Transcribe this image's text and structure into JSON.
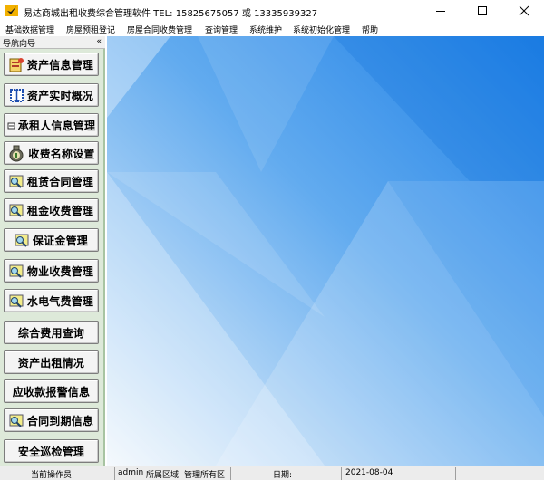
{
  "window": {
    "title": "易达商城出租收费综合管理软件  TEL: 15825675057 或 13335939327",
    "controls": [
      "minimize-icon",
      "maximize-icon",
      "close-icon"
    ]
  },
  "menu": [
    "基础数据管理",
    "房屋预租登记",
    "房屋合同收费管理",
    "查询管理",
    "系统维护",
    "系统初始化管理",
    "帮助"
  ],
  "sidebar": {
    "title": "导航向导",
    "collapse": "«",
    "items": [
      {
        "label": "资产信息管理",
        "icon": "asset-info-icon"
      },
      {
        "label": "资产实时概况",
        "icon": "asset-overview-icon"
      },
      {
        "label": "承租人信息管理",
        "icon": "tenant-info-icon"
      },
      {
        "label": "收费名称设置",
        "icon": "money-bag-icon"
      },
      {
        "label": "租赁合同管理",
        "icon": "lease-contract-icon"
      },
      {
        "label": "租金收费管理",
        "icon": "rent-fee-icon"
      },
      {
        "label": "保证金管理",
        "icon": "deposit-icon"
      },
      {
        "label": "物业收费管理",
        "icon": "property-fee-icon"
      },
      {
        "label": "水电气费管理",
        "icon": "utility-fee-icon"
      },
      {
        "label": "综合费用查询",
        "icon": ""
      },
      {
        "label": "资产出租情况",
        "icon": ""
      },
      {
        "label": "应收款报警信息",
        "icon": ""
      },
      {
        "label": "合同到期信息",
        "icon": "contract-expiry-icon"
      },
      {
        "label": "安全巡检管理",
        "icon": ""
      }
    ]
  },
  "status": {
    "operator_label": "当前操作员:",
    "operator_value": "admin",
    "area_label": "所属区域:",
    "area_value": "管理所有区",
    "date_label": "日期:",
    "date_value": "2021-08-04"
  },
  "colors": {
    "sidebar_bg": "#dde9d9",
    "main_bg_light": "#e6f2fb",
    "main_bg_dark": "#2f8ae8",
    "statusbar_bg": "#ececec"
  }
}
